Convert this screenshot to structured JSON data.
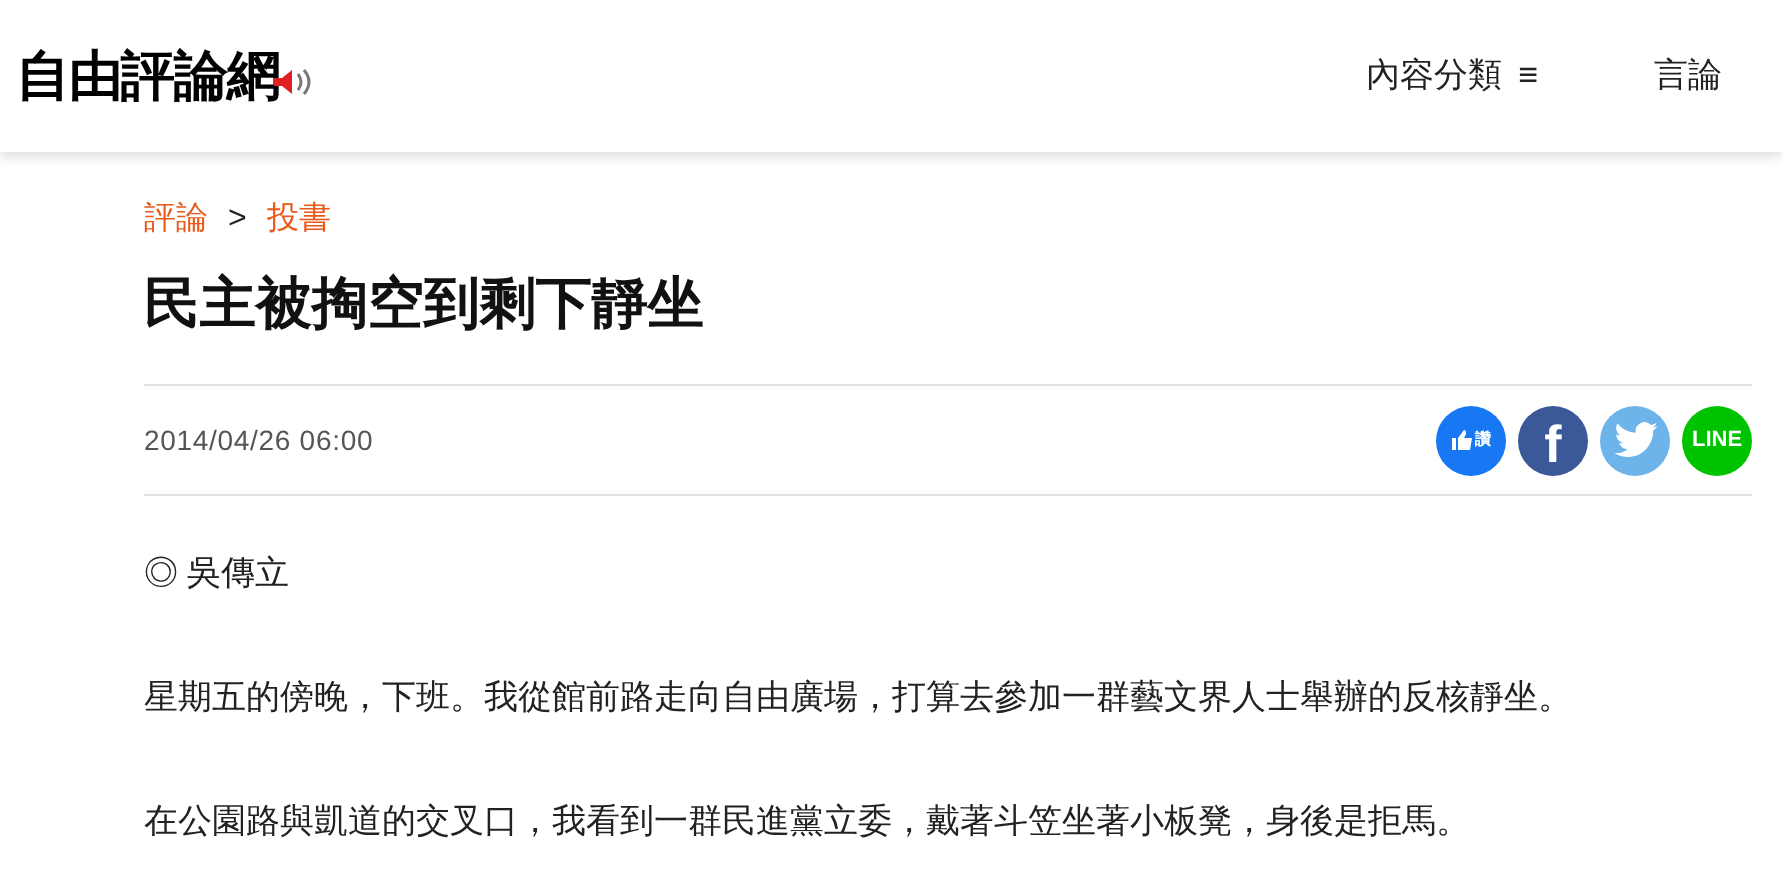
{
  "header": {
    "logo": "自由評論網",
    "nav": [
      {
        "label": "內容分類",
        "icon": "≡"
      },
      {
        "label": "言論"
      }
    ]
  },
  "breadcrumb": [
    "評論",
    ">",
    "投書"
  ],
  "title": "民主被掏空到剩下靜坐",
  "date": "2014/04/26 06:00",
  "share": [
    {
      "kind": "like",
      "label": "讚",
      "color": "#1877f2"
    },
    {
      "kind": "facebook",
      "label": "f",
      "color": "#3b5998"
    },
    {
      "kind": "twitter",
      "color": "#6cb4ea"
    },
    {
      "kind": "line",
      "label": "LINE",
      "color": "#00c300"
    }
  ],
  "author": "◎ 吳傳立",
  "paragraphs": [
    "星期五的傍晚，下班。我從館前路走向自由廣場，打算去參加一群藝文界人士舉辦的反核靜坐。",
    "在公園路與凱道的交叉口，我看到一群民進黨立委，戴著斗笠坐著小板凳，身後是拒馬。"
  ]
}
